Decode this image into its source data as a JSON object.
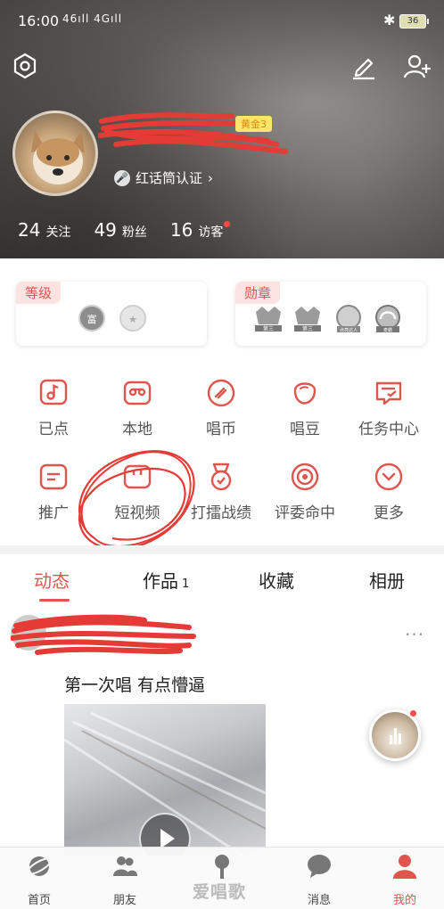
{
  "status_bar": {
    "time": "16:00",
    "signal": "46ıll 4Gıll",
    "battery": "36"
  },
  "header": {
    "vip_badge": "黄金3",
    "certification": "红话筒认证",
    "stats": [
      {
        "num": "24",
        "label": "关注"
      },
      {
        "num": "49",
        "label": "粉丝"
      },
      {
        "num": "16",
        "label": "访客"
      }
    ]
  },
  "level_card": {
    "tag": "等级",
    "badges": [
      "富",
      "★"
    ]
  },
  "medal_card": {
    "tag": "勋章",
    "medals": [
      "第三",
      "第三",
      "点亮达人",
      "麦霸"
    ]
  },
  "grid": [
    {
      "label": "已点",
      "icon": "music-note-icon"
    },
    {
      "label": "本地",
      "icon": "cassette-icon"
    },
    {
      "label": "唱币",
      "icon": "coin-icon"
    },
    {
      "label": "唱豆",
      "icon": "bean-icon"
    },
    {
      "label": "任务中心",
      "icon": "task-icon"
    },
    {
      "label": "推广",
      "icon": "promote-icon"
    },
    {
      "label": "短视频",
      "icon": "video-icon"
    },
    {
      "label": "打擂战绩",
      "icon": "medal-icon"
    },
    {
      "label": "评委命中",
      "icon": "target-icon"
    },
    {
      "label": "更多",
      "icon": "more-icon"
    }
  ],
  "tabs": [
    {
      "label": "动态",
      "count": ""
    },
    {
      "label": "作品",
      "count": "1"
    },
    {
      "label": "收藏",
      "count": ""
    },
    {
      "label": "相册",
      "count": ""
    }
  ],
  "feed": {
    "text": "第一次唱 有点懵逼",
    "more": "···"
  },
  "bottom_nav": [
    {
      "label": "首页",
      "icon": "planet-icon"
    },
    {
      "label": "朋友",
      "icon": "friends-icon"
    },
    {
      "label": "",
      "icon": "microphone-icon"
    },
    {
      "label": "消息",
      "icon": "message-icon"
    },
    {
      "label": "我的",
      "icon": "profile-icon"
    }
  ],
  "watermark": "爱唱歌",
  "colors": {
    "accent": "#e0554d",
    "gold": "#ffe46b"
  }
}
